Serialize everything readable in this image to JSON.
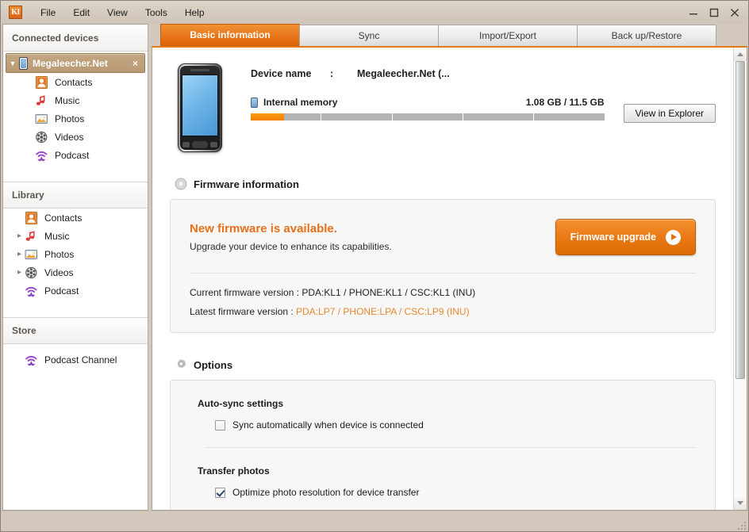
{
  "window": {
    "app_icon_text": "KI",
    "menus": [
      "File",
      "Edit",
      "View",
      "Tools",
      "Help"
    ],
    "controls": {
      "minimize": "minimize-icon",
      "maximize": "maximize-icon",
      "close": "close-icon"
    }
  },
  "sidebar": {
    "connected_header": "Connected devices",
    "device": {
      "name": "Megaleecher.Net",
      "expanded": true,
      "close_label": "×",
      "children": [
        {
          "label": "Contacts",
          "icon": "contacts-icon"
        },
        {
          "label": "Music",
          "icon": "music-icon"
        },
        {
          "label": "Photos",
          "icon": "photos-icon"
        },
        {
          "label": "Videos",
          "icon": "videos-icon"
        },
        {
          "label": "Podcast",
          "icon": "podcast-icon"
        }
      ]
    },
    "library_header": "Library",
    "library_items": [
      {
        "label": "Contacts",
        "icon": "contacts-icon",
        "expandable": false
      },
      {
        "label": "Music",
        "icon": "music-icon",
        "expandable": true
      },
      {
        "label": "Photos",
        "icon": "photos-icon",
        "expandable": true
      },
      {
        "label": "Videos",
        "icon": "videos-icon",
        "expandable": true
      },
      {
        "label": "Podcast",
        "icon": "podcast-icon",
        "expandable": false
      }
    ],
    "store_header": "Store",
    "store_items": [
      {
        "label": "Podcast Channel",
        "icon": "podcast-icon"
      }
    ]
  },
  "tabs": [
    {
      "label": "Basic information",
      "active": true
    },
    {
      "label": "Sync",
      "active": false
    },
    {
      "label": "Import/Export",
      "active": false
    },
    {
      "label": "Back up/Restore",
      "active": false
    }
  ],
  "device_summary": {
    "name_label": "Device name",
    "colon": ":",
    "name_value": "Megaleecher.Net (...",
    "memory_label": "Internal memory",
    "memory_value": "1.08 GB / 11.5 GB",
    "memory_percent": 9.4,
    "memory_segments": 5,
    "explorer_button": "View in Explorer"
  },
  "firmware": {
    "section_title": "Firmware information",
    "headline": "New firmware is available.",
    "subtext": "Upgrade your device to enhance its capabilities.",
    "upgrade_button": "Firmware upgrade",
    "current_label": "Current firmware version : ",
    "current_value": "PDA:KL1 / PHONE:KL1 / CSC:KL1 (INU)",
    "latest_label": "Latest firmware version : ",
    "latest_value": "PDA:LP7 / PHONE:LPA / CSC:LP9 (INU)"
  },
  "options": {
    "section_title": "Options",
    "groups": [
      {
        "title": "Auto-sync settings",
        "checkbox_label": "Sync automatically when device is connected",
        "checked": false
      },
      {
        "title": "Transfer photos",
        "checkbox_label": "Optimize photo resolution for device transfer",
        "checked": true
      }
    ]
  },
  "colors": {
    "accent_orange": "#e8701a",
    "tab_active": "#e8761a",
    "titlebar": "#d5ccbf",
    "device_row": "#b99a74",
    "latest_version": "#e8872c"
  }
}
